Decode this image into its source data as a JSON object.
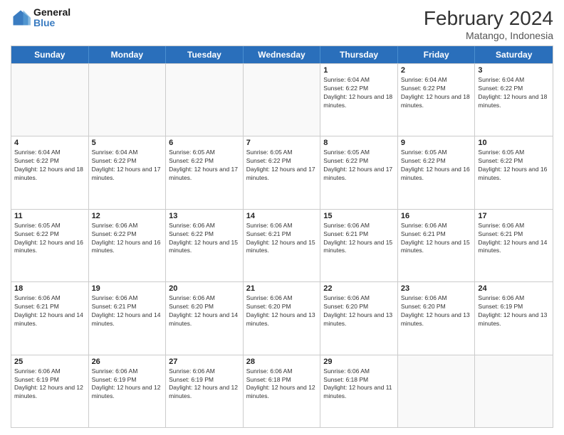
{
  "header": {
    "logo_line1": "General",
    "logo_line2": "Blue",
    "title": "February 2024",
    "subtitle": "Matango, Indonesia"
  },
  "days_of_week": [
    "Sunday",
    "Monday",
    "Tuesday",
    "Wednesday",
    "Thursday",
    "Friday",
    "Saturday"
  ],
  "weeks": [
    [
      {
        "day": "",
        "info": ""
      },
      {
        "day": "",
        "info": ""
      },
      {
        "day": "",
        "info": ""
      },
      {
        "day": "",
        "info": ""
      },
      {
        "day": "1",
        "info": "Sunrise: 6:04 AM\nSunset: 6:22 PM\nDaylight: 12 hours and 18 minutes."
      },
      {
        "day": "2",
        "info": "Sunrise: 6:04 AM\nSunset: 6:22 PM\nDaylight: 12 hours and 18 minutes."
      },
      {
        "day": "3",
        "info": "Sunrise: 6:04 AM\nSunset: 6:22 PM\nDaylight: 12 hours and 18 minutes."
      }
    ],
    [
      {
        "day": "4",
        "info": "Sunrise: 6:04 AM\nSunset: 6:22 PM\nDaylight: 12 hours and 18 minutes."
      },
      {
        "day": "5",
        "info": "Sunrise: 6:04 AM\nSunset: 6:22 PM\nDaylight: 12 hours and 17 minutes."
      },
      {
        "day": "6",
        "info": "Sunrise: 6:05 AM\nSunset: 6:22 PM\nDaylight: 12 hours and 17 minutes."
      },
      {
        "day": "7",
        "info": "Sunrise: 6:05 AM\nSunset: 6:22 PM\nDaylight: 12 hours and 17 minutes."
      },
      {
        "day": "8",
        "info": "Sunrise: 6:05 AM\nSunset: 6:22 PM\nDaylight: 12 hours and 17 minutes."
      },
      {
        "day": "9",
        "info": "Sunrise: 6:05 AM\nSunset: 6:22 PM\nDaylight: 12 hours and 16 minutes."
      },
      {
        "day": "10",
        "info": "Sunrise: 6:05 AM\nSunset: 6:22 PM\nDaylight: 12 hours and 16 minutes."
      }
    ],
    [
      {
        "day": "11",
        "info": "Sunrise: 6:05 AM\nSunset: 6:22 PM\nDaylight: 12 hours and 16 minutes."
      },
      {
        "day": "12",
        "info": "Sunrise: 6:06 AM\nSunset: 6:22 PM\nDaylight: 12 hours and 16 minutes."
      },
      {
        "day": "13",
        "info": "Sunrise: 6:06 AM\nSunset: 6:22 PM\nDaylight: 12 hours and 15 minutes."
      },
      {
        "day": "14",
        "info": "Sunrise: 6:06 AM\nSunset: 6:21 PM\nDaylight: 12 hours and 15 minutes."
      },
      {
        "day": "15",
        "info": "Sunrise: 6:06 AM\nSunset: 6:21 PM\nDaylight: 12 hours and 15 minutes."
      },
      {
        "day": "16",
        "info": "Sunrise: 6:06 AM\nSunset: 6:21 PM\nDaylight: 12 hours and 15 minutes."
      },
      {
        "day": "17",
        "info": "Sunrise: 6:06 AM\nSunset: 6:21 PM\nDaylight: 12 hours and 14 minutes."
      }
    ],
    [
      {
        "day": "18",
        "info": "Sunrise: 6:06 AM\nSunset: 6:21 PM\nDaylight: 12 hours and 14 minutes."
      },
      {
        "day": "19",
        "info": "Sunrise: 6:06 AM\nSunset: 6:21 PM\nDaylight: 12 hours and 14 minutes."
      },
      {
        "day": "20",
        "info": "Sunrise: 6:06 AM\nSunset: 6:20 PM\nDaylight: 12 hours and 14 minutes."
      },
      {
        "day": "21",
        "info": "Sunrise: 6:06 AM\nSunset: 6:20 PM\nDaylight: 12 hours and 13 minutes."
      },
      {
        "day": "22",
        "info": "Sunrise: 6:06 AM\nSunset: 6:20 PM\nDaylight: 12 hours and 13 minutes."
      },
      {
        "day": "23",
        "info": "Sunrise: 6:06 AM\nSunset: 6:20 PM\nDaylight: 12 hours and 13 minutes."
      },
      {
        "day": "24",
        "info": "Sunrise: 6:06 AM\nSunset: 6:19 PM\nDaylight: 12 hours and 13 minutes."
      }
    ],
    [
      {
        "day": "25",
        "info": "Sunrise: 6:06 AM\nSunset: 6:19 PM\nDaylight: 12 hours and 12 minutes."
      },
      {
        "day": "26",
        "info": "Sunrise: 6:06 AM\nSunset: 6:19 PM\nDaylight: 12 hours and 12 minutes."
      },
      {
        "day": "27",
        "info": "Sunrise: 6:06 AM\nSunset: 6:19 PM\nDaylight: 12 hours and 12 minutes."
      },
      {
        "day": "28",
        "info": "Sunrise: 6:06 AM\nSunset: 6:18 PM\nDaylight: 12 hours and 12 minutes."
      },
      {
        "day": "29",
        "info": "Sunrise: 6:06 AM\nSunset: 6:18 PM\nDaylight: 12 hours and 11 minutes."
      },
      {
        "day": "",
        "info": ""
      },
      {
        "day": "",
        "info": ""
      }
    ]
  ]
}
